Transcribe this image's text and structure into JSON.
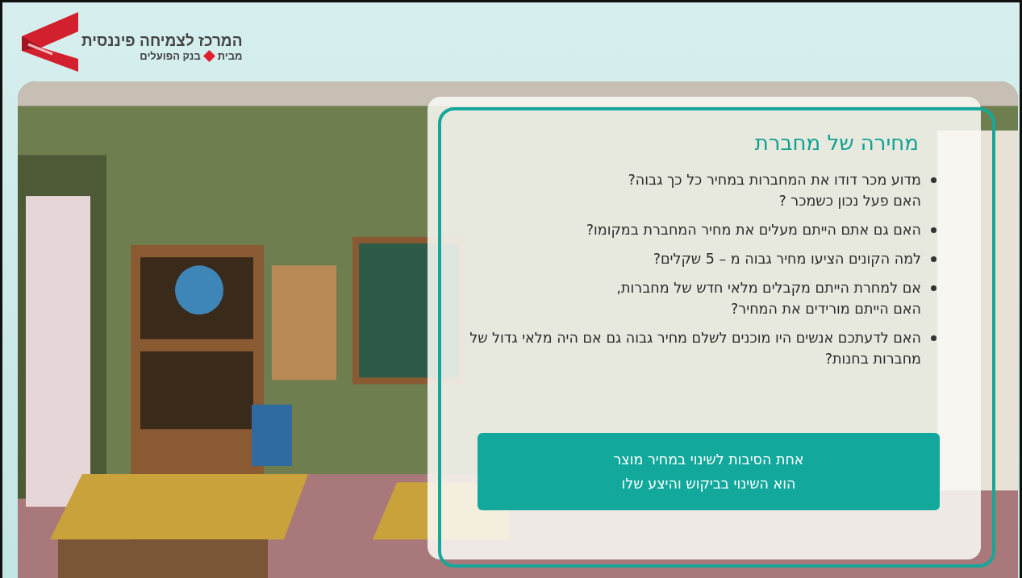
{
  "logo": {
    "title": "המרכז לצמיחה פיננסית",
    "subtitle_before": "מבית",
    "subtitle_after": "בנק הפועלים"
  },
  "slide": {
    "title": "מחירה של מחברת",
    "bullets": [
      {
        "lines": [
          "מדוע מכר דודו את המחברות במחיר כל כך גבוה?",
          "האם פעל נכון כשמכר ?"
        ]
      },
      {
        "lines": [
          "האם גם אתם הייתם מעלים את מחיר המחברת במקומו?"
        ]
      },
      {
        "lines": [
          "למה הקונים הציעו מחיר גבוה מ – 5 שקלים?"
        ]
      },
      {
        "lines": [
          "אם למחרת הייתם מקבלים מלאי חדש של מחברות,",
          "האם הייתם מורידים את המחיר?"
        ]
      },
      {
        "lines": [
          "האם לדעתכם אנשים היו מוכנים לשלם מחיר גבוה גם אם היה מלאי גדול של מחברות בחנות?"
        ]
      }
    ],
    "note": {
      "lines": [
        "אחת הסיבות לשינוי במחיר מוצר",
        "הוא השינוי בביקוש והיצע שלו"
      ]
    }
  }
}
